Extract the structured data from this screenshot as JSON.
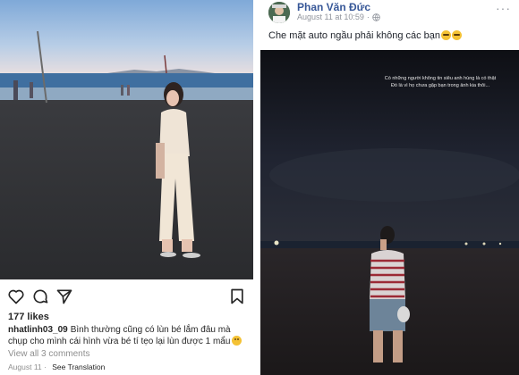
{
  "instagram": {
    "likes": "177 likes",
    "caption_user": "nhatlinh03_09",
    "caption_text": "Bình thường cũng có lùn bé lắm đâu mà chụp cho mình cái hình vừa bé tí tẹo lại lùn được 1 mẩu",
    "caption_emoji": "sweat-smile-emoji",
    "view_all": "View all 3 comments",
    "date": "August 11",
    "separator": "·",
    "see_translation": "See Translation",
    "icons": [
      "heart-icon",
      "comment-icon",
      "share-icon",
      "bookmark-icon"
    ]
  },
  "facebook": {
    "author": "Phan Văn Đức",
    "date": "August 11 at 10:59",
    "separator": "·",
    "post_text": "Che mặt auto ngầu phải không các bạn",
    "post_emoji": "grimace-emoji",
    "overlay_line1": "Có những người không tin siêu anh hùng là có thật",
    "overlay_line2": "Đó là vì họ chưa gặp bạn trong ảnh kia thôi...",
    "more": "···",
    "icons": [
      "globe-icon",
      "more-icon"
    ]
  },
  "colors": {
    "fb_link": "#385898",
    "meta_grey": "#90949c",
    "ig_text": "#262626",
    "ig_grey": "#8e8e8e"
  }
}
